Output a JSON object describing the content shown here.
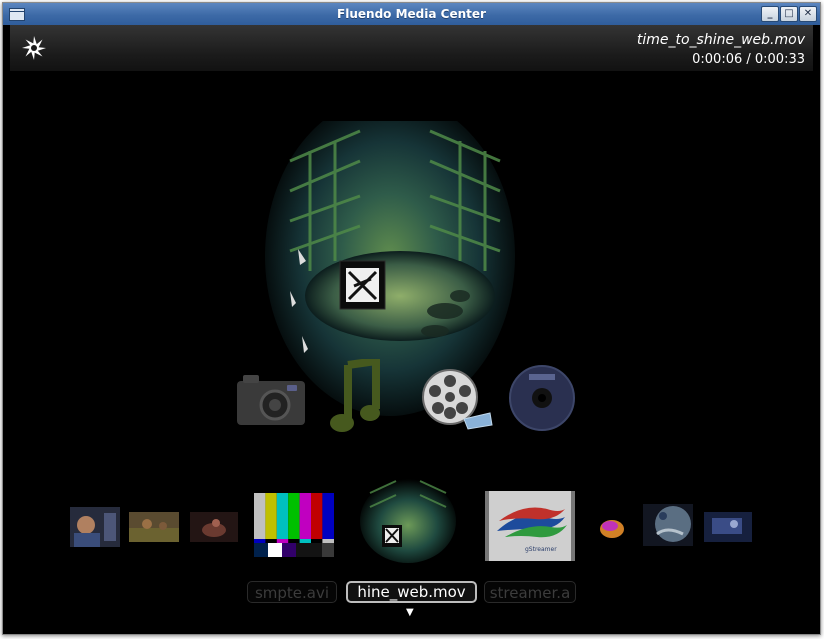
{
  "window": {
    "title": "Fluendo Media Center",
    "controls": [
      "minimize",
      "maximize",
      "close"
    ]
  },
  "header": {
    "logo_icon": "fluendo-swirl-icon",
    "now_playing": "time_to_shine_web.mov",
    "position": "0:00:06 / 0:00:33"
  },
  "menu": {
    "items": [
      {
        "icon": "camera-icon",
        "name": "photos"
      },
      {
        "icon": "music-note-icon",
        "name": "music"
      },
      {
        "icon": "film-reel-icon",
        "name": "videos"
      },
      {
        "icon": "dvd-icon",
        "name": "dvd"
      }
    ],
    "selected": "videos"
  },
  "carousel": {
    "labels": {
      "prev": "smpte.avi",
      "current": "hine_web.mov",
      "next": "streamer.a"
    },
    "selected_marker": "▼"
  },
  "colors": {
    "background": "#000000",
    "titlebar": "#3d6aa7",
    "label_active_border": "#bdbdbd"
  }
}
